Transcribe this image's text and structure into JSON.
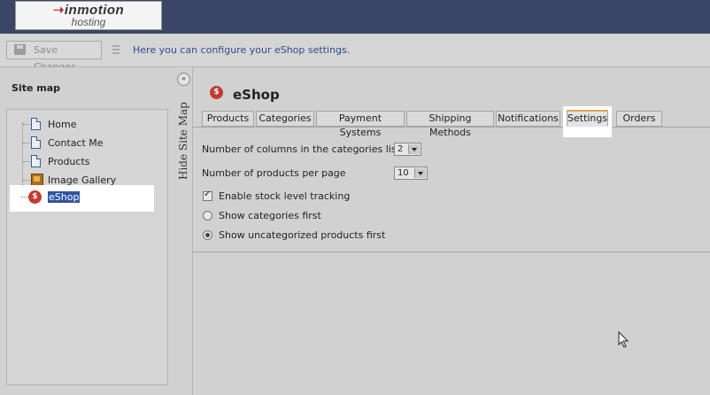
{
  "brand": {
    "line1": "inmotion",
    "line2": "hosting"
  },
  "toolbar": {
    "save_label": "Save Changes",
    "info_text": "Here you can configure your eShop settings."
  },
  "sidebar": {
    "title": "Site map",
    "items": [
      {
        "label": "Home",
        "icon": "page-icon"
      },
      {
        "label": "Contact Me",
        "icon": "page-icon"
      },
      {
        "label": "Products",
        "icon": "page-icon"
      },
      {
        "label": "Image Gallery",
        "icon": "gallery-icon"
      },
      {
        "label": "eShop",
        "icon": "eshop-icon",
        "selected": true
      }
    ],
    "hide_label": "Hide Site Map"
  },
  "main": {
    "title": "eShop",
    "tabs": [
      {
        "label": "Products"
      },
      {
        "label": "Categories"
      },
      {
        "label": "Payment Systems"
      },
      {
        "label": "Shipping Methods"
      },
      {
        "label": "Notifications"
      },
      {
        "label": "Settings",
        "active": true
      },
      {
        "label": "Orders"
      }
    ],
    "settings": {
      "columns_label": "Number of columns in the categories list",
      "columns_value": "2",
      "products_label": "Number of products per page",
      "products_value": "10",
      "stock_label": "Enable stock level tracking",
      "stock_checked": true,
      "radio1_label": "Show categories first",
      "radio2_label": "Show uncategorized products first",
      "radio_selected": "Show uncategorized products first"
    }
  },
  "colors": {
    "topbar": "#3a4666",
    "accent_tab": "#e2a44a",
    "link": "#2a4f8a",
    "selection": "#2f55a0"
  }
}
